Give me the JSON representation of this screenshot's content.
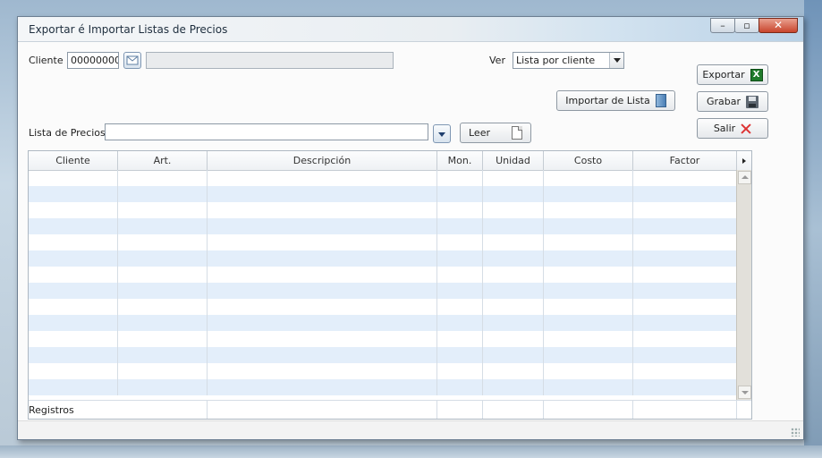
{
  "window": {
    "title": "Exportar é Importar Listas de Precios"
  },
  "cliente": {
    "label": "Cliente",
    "code": "00000000",
    "name": ""
  },
  "ver": {
    "label": "Ver",
    "selected": "Lista por cliente"
  },
  "lista": {
    "label": "Lista de Precios",
    "value": ""
  },
  "buttons": {
    "exportar": "Exportar",
    "grabar": "Grabar",
    "salir": "Salir",
    "importar": "Importar de Lista",
    "leer": "Leer"
  },
  "grid": {
    "columns": [
      "Cliente",
      "Art.",
      "Descripción",
      "Mon.",
      "Unidad",
      "Costo",
      "Factor"
    ],
    "rows": [],
    "footer_label": "Registros"
  },
  "icons": {
    "lookup": "envelope-icon",
    "exportar": "excel-icon",
    "grabar": "save-icon",
    "salir": "close-icon",
    "importar": "import-icon",
    "leer": "document-icon"
  }
}
